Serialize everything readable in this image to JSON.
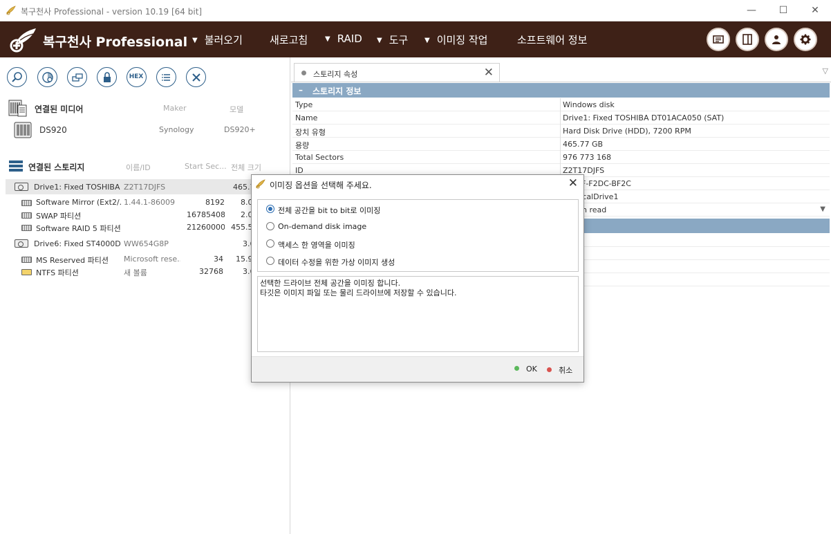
{
  "window": {
    "title": "복구천사 Professional - version 10.19 [64 bit]",
    "minimize": "—",
    "maximize": "☐",
    "close": "✕"
  },
  "menubar": {
    "brand": "복구천사 Professional",
    "items": [
      {
        "label": "불러오기",
        "dropdown": true
      },
      {
        "label": "새로고침",
        "dropdown": false
      },
      {
        "label": "RAID",
        "dropdown": true
      },
      {
        "label": "도구",
        "dropdown": true
      },
      {
        "label": "이미징 작업",
        "dropdown": true
      },
      {
        "label": "소프트웨어 정보",
        "dropdown": false
      }
    ],
    "arrow": "▼",
    "right_icons": [
      "card-icon",
      "panel-icon",
      "user-icon",
      "gear-icon"
    ],
    "bg_color": "#3e2117"
  },
  "toolbar": {
    "icons": [
      "search-icon",
      "scan-icon",
      "copy-icon",
      "lock-icon",
      "hex-icon",
      "list-icon",
      "close-icon"
    ],
    "hex_label": "HEX"
  },
  "media": {
    "section_title": "연결된 미디어",
    "col_maker": "Maker",
    "col_model": "모델",
    "items": [
      {
        "name": "DS920",
        "maker": "Synology",
        "model": "DS920+"
      }
    ]
  },
  "storage": {
    "section_title": "연결된 스토리지",
    "col_name": "이름/ID",
    "col_start": "Start Sec...",
    "col_size": "전체 크기",
    "rows": [
      {
        "name": "Drive1: Fixed TOSHIBA ...",
        "id": "Z2T17DJFS",
        "start": "",
        "size": "465.7",
        "kind": "disk",
        "selected": true
      },
      {
        "name": "Software Mirror (Ext2/...",
        "id": "1.44.1-86009",
        "start": "8192",
        "size": "8.0",
        "kind": "part"
      },
      {
        "name": "SWAP 파티션",
        "id": "",
        "start": "16785408",
        "size": "2.0",
        "kind": "part"
      },
      {
        "name": "Software RAID 5 파티션",
        "id": "",
        "start": "21260000",
        "size": "455.5",
        "kind": "part"
      },
      {
        "name": "Drive6: Fixed ST4000D...",
        "id": "WW654G8P",
        "start": "",
        "size": "3.6",
        "kind": "disk"
      },
      {
        "name": "MS Reserved 파티션",
        "id": "Microsoft rese...",
        "start": "34",
        "size": "15.9",
        "kind": "part"
      },
      {
        "name": "NTFS 파티션",
        "id": "새 볼륨",
        "start": "32768",
        "size": "3.6",
        "kind": "part"
      }
    ]
  },
  "props": {
    "tab_label": "스토리지 속성",
    "tab_close": "✕",
    "tab_menu": "▽",
    "group_title": "스토리지 정보",
    "group_collapse": "–",
    "rows": [
      {
        "k": "Type",
        "v": "Windows disk"
      },
      {
        "k": "Name",
        "v": "Drive1: Fixed TOSHIBA DT01ACA050 (SAT)"
      },
      {
        "k": "장치 유형",
        "v": "Hard Disk Drive (HDD), 7200 RPM"
      },
      {
        "k": "용량",
        "v": "465.77 GB"
      },
      {
        "k": "Total Sectors",
        "v": "976 773 168"
      },
      {
        "k": "ID",
        "v": "Z2T17DJFS"
      },
      {
        "k": "",
        "v": "039F-F2DC-BF2C"
      },
      {
        "k": "",
        "v": "hysicalDrive1"
      },
      {
        "k": "",
        "v": "n read"
      }
    ],
    "dropdown_arrow": "▼"
  },
  "dialog": {
    "title": "이미징  옵션을 선택해 주세요.",
    "close": "✕",
    "options": [
      {
        "label": "전체 공간을 bit to bit로 이미징",
        "checked": true
      },
      {
        "label": "On-demand disk image",
        "checked": false
      },
      {
        "label": "액세스 한 영역을 이미징",
        "checked": false
      },
      {
        "label": "데이터 수정을 위한 가상 이미지 생성",
        "checked": false
      }
    ],
    "description": [
      "선택한 드라이브 전체 공간을 이미징 합니다.",
      "타깃은 이미지 파일 또는 물리 드라이브에 저장할 수 있습니다."
    ],
    "ok_label": "OK",
    "cancel_label": "취소",
    "ok_color": "#5cb85c",
    "cancel_color": "#d9534f"
  }
}
